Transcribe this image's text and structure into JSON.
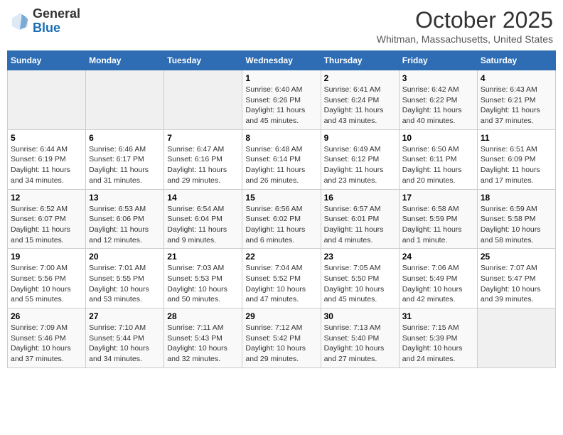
{
  "header": {
    "logo_general": "General",
    "logo_blue": "Blue",
    "month": "October 2025",
    "location": "Whitman, Massachusetts, United States"
  },
  "weekdays": [
    "Sunday",
    "Monday",
    "Tuesday",
    "Wednesday",
    "Thursday",
    "Friday",
    "Saturday"
  ],
  "weeks": [
    [
      {
        "day": "",
        "info": ""
      },
      {
        "day": "",
        "info": ""
      },
      {
        "day": "",
        "info": ""
      },
      {
        "day": "1",
        "info": "Sunrise: 6:40 AM\nSunset: 6:26 PM\nDaylight: 11 hours and 45 minutes."
      },
      {
        "day": "2",
        "info": "Sunrise: 6:41 AM\nSunset: 6:24 PM\nDaylight: 11 hours and 43 minutes."
      },
      {
        "day": "3",
        "info": "Sunrise: 6:42 AM\nSunset: 6:22 PM\nDaylight: 11 hours and 40 minutes."
      },
      {
        "day": "4",
        "info": "Sunrise: 6:43 AM\nSunset: 6:21 PM\nDaylight: 11 hours and 37 minutes."
      }
    ],
    [
      {
        "day": "5",
        "info": "Sunrise: 6:44 AM\nSunset: 6:19 PM\nDaylight: 11 hours and 34 minutes."
      },
      {
        "day": "6",
        "info": "Sunrise: 6:46 AM\nSunset: 6:17 PM\nDaylight: 11 hours and 31 minutes."
      },
      {
        "day": "7",
        "info": "Sunrise: 6:47 AM\nSunset: 6:16 PM\nDaylight: 11 hours and 29 minutes."
      },
      {
        "day": "8",
        "info": "Sunrise: 6:48 AM\nSunset: 6:14 PM\nDaylight: 11 hours and 26 minutes."
      },
      {
        "day": "9",
        "info": "Sunrise: 6:49 AM\nSunset: 6:12 PM\nDaylight: 11 hours and 23 minutes."
      },
      {
        "day": "10",
        "info": "Sunrise: 6:50 AM\nSunset: 6:11 PM\nDaylight: 11 hours and 20 minutes."
      },
      {
        "day": "11",
        "info": "Sunrise: 6:51 AM\nSunset: 6:09 PM\nDaylight: 11 hours and 17 minutes."
      }
    ],
    [
      {
        "day": "12",
        "info": "Sunrise: 6:52 AM\nSunset: 6:07 PM\nDaylight: 11 hours and 15 minutes."
      },
      {
        "day": "13",
        "info": "Sunrise: 6:53 AM\nSunset: 6:06 PM\nDaylight: 11 hours and 12 minutes."
      },
      {
        "day": "14",
        "info": "Sunrise: 6:54 AM\nSunset: 6:04 PM\nDaylight: 11 hours and 9 minutes."
      },
      {
        "day": "15",
        "info": "Sunrise: 6:56 AM\nSunset: 6:02 PM\nDaylight: 11 hours and 6 minutes."
      },
      {
        "day": "16",
        "info": "Sunrise: 6:57 AM\nSunset: 6:01 PM\nDaylight: 11 hours and 4 minutes."
      },
      {
        "day": "17",
        "info": "Sunrise: 6:58 AM\nSunset: 5:59 PM\nDaylight: 11 hours and 1 minute."
      },
      {
        "day": "18",
        "info": "Sunrise: 6:59 AM\nSunset: 5:58 PM\nDaylight: 10 hours and 58 minutes."
      }
    ],
    [
      {
        "day": "19",
        "info": "Sunrise: 7:00 AM\nSunset: 5:56 PM\nDaylight: 10 hours and 55 minutes."
      },
      {
        "day": "20",
        "info": "Sunrise: 7:01 AM\nSunset: 5:55 PM\nDaylight: 10 hours and 53 minutes."
      },
      {
        "day": "21",
        "info": "Sunrise: 7:03 AM\nSunset: 5:53 PM\nDaylight: 10 hours and 50 minutes."
      },
      {
        "day": "22",
        "info": "Sunrise: 7:04 AM\nSunset: 5:52 PM\nDaylight: 10 hours and 47 minutes."
      },
      {
        "day": "23",
        "info": "Sunrise: 7:05 AM\nSunset: 5:50 PM\nDaylight: 10 hours and 45 minutes."
      },
      {
        "day": "24",
        "info": "Sunrise: 7:06 AM\nSunset: 5:49 PM\nDaylight: 10 hours and 42 minutes."
      },
      {
        "day": "25",
        "info": "Sunrise: 7:07 AM\nSunset: 5:47 PM\nDaylight: 10 hours and 39 minutes."
      }
    ],
    [
      {
        "day": "26",
        "info": "Sunrise: 7:09 AM\nSunset: 5:46 PM\nDaylight: 10 hours and 37 minutes."
      },
      {
        "day": "27",
        "info": "Sunrise: 7:10 AM\nSunset: 5:44 PM\nDaylight: 10 hours and 34 minutes."
      },
      {
        "day": "28",
        "info": "Sunrise: 7:11 AM\nSunset: 5:43 PM\nDaylight: 10 hours and 32 minutes."
      },
      {
        "day": "29",
        "info": "Sunrise: 7:12 AM\nSunset: 5:42 PM\nDaylight: 10 hours and 29 minutes."
      },
      {
        "day": "30",
        "info": "Sunrise: 7:13 AM\nSunset: 5:40 PM\nDaylight: 10 hours and 27 minutes."
      },
      {
        "day": "31",
        "info": "Sunrise: 7:15 AM\nSunset: 5:39 PM\nDaylight: 10 hours and 24 minutes."
      },
      {
        "day": "",
        "info": ""
      }
    ]
  ]
}
